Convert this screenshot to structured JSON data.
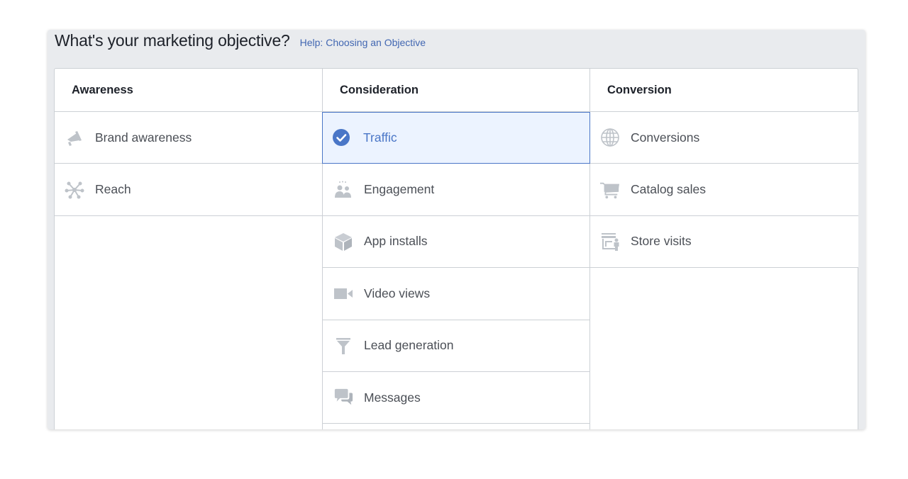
{
  "header": {
    "title": "What's your marketing objective?",
    "help_link": "Help: Choosing an Objective"
  },
  "columns": [
    {
      "title": "Awareness",
      "items": [
        {
          "label": "Brand awareness",
          "icon": "megaphone-icon"
        },
        {
          "label": "Reach",
          "icon": "reach-icon"
        }
      ]
    },
    {
      "title": "Consideration",
      "items": [
        {
          "label": "Traffic",
          "icon": "check-circle-icon",
          "selected": true
        },
        {
          "label": "Engagement",
          "icon": "people-icon"
        },
        {
          "label": "App installs",
          "icon": "box-icon"
        },
        {
          "label": "Video views",
          "icon": "video-camera-icon"
        },
        {
          "label": "Lead generation",
          "icon": "funnel-icon"
        },
        {
          "label": "Messages",
          "icon": "chat-bubbles-icon"
        }
      ]
    },
    {
      "title": "Conversion",
      "items": [
        {
          "label": "Conversions",
          "icon": "globe-icon"
        },
        {
          "label": "Catalog sales",
          "icon": "shopping-cart-icon"
        },
        {
          "label": "Store visits",
          "icon": "store-icon"
        }
      ]
    }
  ],
  "colors": {
    "accent": "#4a76c7",
    "selected_bg": "#ecf3ff",
    "icon": "#bec3c9",
    "link": "#4267b2"
  }
}
